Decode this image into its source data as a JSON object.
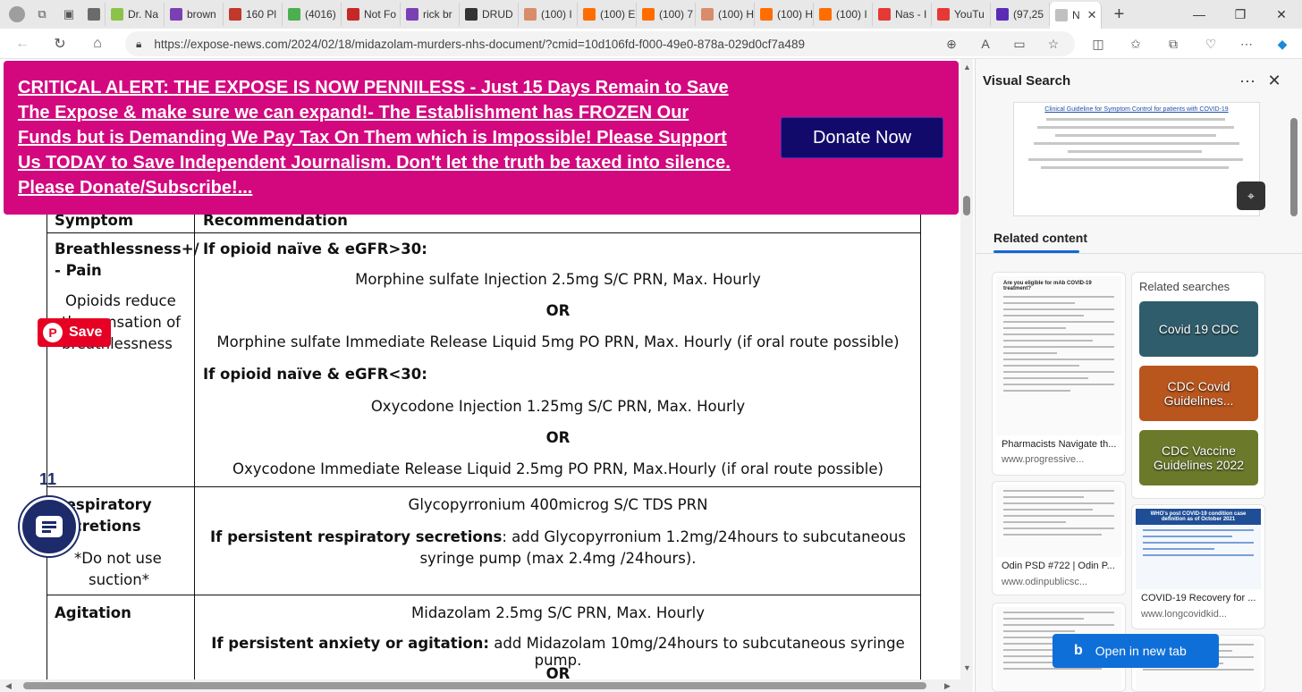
{
  "browser": {
    "tabs": [
      {
        "label": "",
        "color": "#6b6b6b"
      },
      {
        "label": "Dr. Na",
        "color": "#8bc34a"
      },
      {
        "label": "brown",
        "color": "#7b3fb5"
      },
      {
        "label": "160 Pl",
        "color": "#c0392b"
      },
      {
        "label": "(4016)",
        "color": "#4caf50"
      },
      {
        "label": "Not Fo",
        "color": "#c62828"
      },
      {
        "label": "rick br",
        "color": "#7b3fb5"
      },
      {
        "label": "DRUD",
        "color": "#333333"
      },
      {
        "label": "(100) I",
        "color": "#d98c6a"
      },
      {
        "label": "(100) E",
        "color": "#ff6d00"
      },
      {
        "label": "(100) 7",
        "color": "#ff6d00"
      },
      {
        "label": "(100) H",
        "color": "#d98c6a"
      },
      {
        "label": "(100) H",
        "color": "#ff6d00"
      },
      {
        "label": "(100) I",
        "color": "#ff6d00"
      },
      {
        "label": "Nas - I",
        "color": "#e53935"
      },
      {
        "label": "YouTu",
        "color": "#e53935"
      },
      {
        "label": "(97,25",
        "color": "#5a2bb5"
      }
    ],
    "active_tab": {
      "label": "N",
      "close": "✕"
    },
    "new_tab": "+",
    "url": "https://expose-news.com/2024/02/18/midazolam-murders-nhs-document/?cmid=10d106fd-f000-49e0-878a-029d0cf7a489"
  },
  "banner": {
    "text": "CRITICAL ALERT: THE EXPOSE IS NOW PENNILESS - Just 15 Days Remain to Save The Expose & make sure we can expand!- The Establishment has FROZEN Our Funds but is Demanding We Pay Tax On Them which is Impossible! Please Support Us TODAY to Save Independent Journalism. Don't let the truth be taxed into silence. Please Donate/Subscribe!...",
    "donate_label": "Donate Now",
    "background": "#d3087f",
    "button_color": "#110a6b"
  },
  "document": {
    "header_left": "Symptom",
    "header_right": "Recommendation",
    "breathless": {
      "title_line1": "Breathlessness+/",
      "title_line2": "- Pain",
      "note_line1": "Opioids reduce",
      "note_line2": "the sensation of",
      "note_line3": "breathlessness",
      "cond1": "If opioid naïve & eGFR>30:",
      "rx1": "Morphine sulfate Injection 2.5mg S/C  PRN, Max. Hourly",
      "or1": "OR",
      "rx2": "Morphine sulfate Immediate Release Liquid 5mg PO PRN, Max. Hourly (if oral route possible)",
      "cond2": "If opioid naïve & eGFR<30:",
      "rx3": "Oxycodone Injection 1.25mg S/C PRN, Max. Hourly",
      "or2": "OR",
      "rx4": "Oxycodone Immediate Release Liquid 2.5mg PO PRN, Max.Hourly (if oral route possible)"
    },
    "respiratory": {
      "title_line1": "Respiratory",
      "title_line2": "secretions",
      "note_line1": "*Do not  use",
      "note_line2": "suction*",
      "rx1": "Glycopyrronium 400microg S/C TDS PRN",
      "cond_bold": "If persistent respiratory secretions",
      "cond_rest": ": add Glycopyrronium 1.2mg/24hours to subcutaneous",
      "cond_line2": "syringe pump (max 2.4mg /24hours)."
    },
    "agitation": {
      "title": "Agitation",
      "rx1": "Midazolam 2.5mg S/C PRN, Max. Hourly",
      "cond_bold": "If persistent anxiety or agitation:",
      "cond_rest": " add Midazolam 10mg/24hours to subcutaneous syringe pump.",
      "or": "OR"
    }
  },
  "overlays": {
    "pin_label": "Save",
    "pin_icon": "P",
    "comment_count": "11"
  },
  "sidebar": {
    "title": "Visual Search",
    "more": "···",
    "close": "✕",
    "preview_title": "Clinical Guideline for Symptom Control for patients with COVID-19",
    "related_heading": "Related content",
    "related_searches_title": "Related searches",
    "cards": [
      {
        "caption": "Pharmacists Navigate th...",
        "source": "www.progressive..."
      },
      {
        "caption": "Odin PSD #722 | Odin P...",
        "source": "www.odinpublicsc..."
      },
      {
        "caption": "COVID-19 Recovery for ...",
        "source": "www.longcovidkid..."
      }
    ],
    "card_doc_title": "Are you eligible for mAb COVID-19 treatment?",
    "card_chart_title": "WHO's post COVID-19 condition case definition as of October 2021",
    "related_searches": [
      {
        "label": "Covid 19 CDC",
        "color": "#2f5d6b"
      },
      {
        "label": "CDC Covid Guidelines...",
        "color": "#b9561e"
      },
      {
        "label": "CDC Vaccine Guidelines 2022",
        "color": "#6b7a2a"
      }
    ],
    "open_label": "Open in new tab",
    "open_icon": "b"
  }
}
